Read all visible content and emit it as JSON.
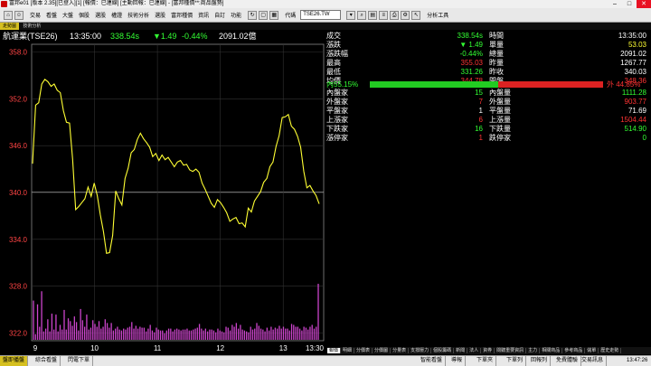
{
  "titlebar": {
    "title": "富邦e01 [版本 2.35][已登入][1] [報價：已連線] [主動回報：已連線] - [富邦種價**:商品盤勢]"
  },
  "toolbar": {
    "items": [
      "交易",
      "看盤",
      "大盤",
      "個股",
      "選股",
      "權證",
      "技術分析",
      "選股",
      "富邦種價",
      "資訊",
      "自訂",
      "功能"
    ],
    "code_label": "代碼",
    "code_value": "TSE26.TW",
    "analysis_label": "分析工具"
  },
  "doc_tabs": [
    "走勢圖",
    "技術分析"
  ],
  "header": {
    "name": "航運業(TSE26)",
    "time": "13:35:00",
    "price": "338.54s",
    "change": "▼1.49",
    "pct": "-0.44%",
    "amount": "2091.02億"
  },
  "chart_data": {
    "type": "line",
    "title": "",
    "x_ticks": [
      "9",
      "10",
      "11",
      "12",
      "13",
      "13:30"
    ],
    "y_ticks": [
      "358.0",
      "352.0",
      "346.0",
      "340.0",
      "334.0",
      "328.0",
      "322.0"
    ],
    "ylim": [
      321.0,
      359.0
    ],
    "reference": 340.03,
    "grid": true,
    "line_color": "#ffff33",
    "volume_color": "#cc44cc",
    "series": [
      {
        "values": [
          343.7,
          351.2,
          351.5,
          353.9,
          354.5,
          354.2,
          353.6,
          353.9,
          353.1,
          352.8,
          350.5,
          349.0,
          348.9,
          344.3,
          337.8,
          338.2,
          338.7,
          339.2,
          340.7,
          339.5,
          341.2,
          339.6,
          337.1,
          335.0,
          332.2,
          332.3,
          334.5,
          340.2,
          339.2,
          338.4,
          341.8,
          343.1,
          345.1,
          345.5,
          346.8,
          347.6,
          346.9,
          346.4,
          345.8,
          344.6,
          345.0,
          344.1,
          344.8,
          344.2,
          344.5,
          343.9,
          343.3,
          343.9,
          344.1,
          343.5,
          343.6,
          342.9,
          342.7,
          343.0,
          342.6,
          341.2,
          340.4,
          339.5,
          338.6,
          338.1,
          339.1,
          338.7,
          338.1,
          337.4,
          336.3,
          336.6,
          336.8,
          336.0,
          336.1,
          335.6,
          338.0,
          337.5,
          338.9,
          339.5,
          340.1,
          341.3,
          341.8,
          343.3,
          343.9,
          345.9,
          347.3,
          349.6,
          349.7,
          350.0,
          348.5,
          348.1,
          347.2,
          345.8,
          342.7,
          340.6,
          340.9,
          340.2,
          339.6,
          338.54
        ]
      }
    ],
    "volume": [
      42,
      6,
      38,
      14,
      52,
      9,
      12,
      22,
      9,
      28,
      11,
      27,
      9,
      16,
      11,
      32,
      11,
      23,
      20,
      15,
      25,
      19,
      10,
      33,
      21,
      14,
      27,
      11,
      13,
      21,
      17,
      14,
      20,
      12,
      14,
      22,
      18,
      13,
      18,
      10,
      12,
      14,
      11,
      10,
      12,
      11,
      13,
      14,
      19,
      12,
      15,
      12,
      14,
      13,
      13,
      9,
      12,
      16,
      10,
      8,
      13,
      11,
      10,
      10,
      7,
      10,
      12,
      12,
      9,
      11,
      12,
      11,
      10,
      11,
      11,
      12,
      10,
      10,
      11,
      12,
      13,
      17,
      12,
      10,
      12,
      9,
      11,
      11,
      10,
      8,
      12,
      10,
      9,
      8,
      14,
      13,
      10,
      16,
      14,
      18,
      12,
      16,
      11,
      10,
      9,
      8,
      14,
      11,
      12,
      18,
      15,
      12,
      11,
      9,
      13,
      10,
      14,
      11,
      13,
      12,
      15,
      12,
      14,
      12,
      12,
      10,
      17,
      16,
      14,
      14,
      12,
      10,
      14,
      13,
      11,
      14,
      16,
      12,
      14,
      60
    ]
  },
  "quote": {
    "left": [
      {
        "label": "成交",
        "value": "338.54s",
        "color": "#33ff33"
      },
      {
        "label": "漲跌",
        "value": "▼ 1.49",
        "color": "#33ff33"
      },
      {
        "label": "漲跌幅",
        "value": "-0.44%",
        "color": "#33ff33"
      },
      {
        "label": "最高",
        "value": "355.03",
        "color": "#ff3333"
      },
      {
        "label": "最低",
        "value": "331.26",
        "color": "#33ff33"
      },
      {
        "label": "均價",
        "value": "344.78",
        "color": "#ff3333"
      }
    ],
    "right": [
      {
        "label": "時間",
        "value": "13:35:00",
        "color": "#ffffff"
      },
      {
        "label": "單量",
        "value": "53.03",
        "color": "#ffff33"
      },
      {
        "label": "總量",
        "value": "2091.02",
        "color": "#ffffff"
      },
      {
        "label": "昨量",
        "value": "1267.77",
        "color": "#ffffff"
      },
      {
        "label": "昨收",
        "value": "340.03",
        "color": "#ffffff"
      },
      {
        "label": "開盤",
        "value": "348.36",
        "color": "#ff3333"
      }
    ],
    "ratio": {
      "inner_label": "內55.15%",
      "outer_label": "外 44.85%",
      "inner_fraction": 0.5515
    },
    "left2": [
      {
        "label": "內盤家",
        "value": "15",
        "color": "#33ff33"
      },
      {
        "label": "外盤家",
        "value": "7",
        "color": "#ff3333"
      },
      {
        "label": "平盤家",
        "value": "1",
        "color": "#ffffff"
      },
      {
        "label": "上漲家",
        "value": "6",
        "color": "#ff3333"
      },
      {
        "label": "下跌家",
        "value": "16",
        "color": "#33ff33"
      },
      {
        "label": "漲停家",
        "value": "1",
        "color": "#ff3333"
      }
    ],
    "right2": [
      {
        "label": "內盤量",
        "value": "1111.28",
        "color": "#33ff33"
      },
      {
        "label": "外盤量",
        "value": "903.77",
        "color": "#ff3333"
      },
      {
        "label": "平盤量",
        "value": "71.69",
        "color": "#ffffff"
      },
      {
        "label": "上漲量",
        "value": "1504.44",
        "color": "#ff3333"
      },
      {
        "label": "下跌量",
        "value": "514.90",
        "color": "#33ff33"
      },
      {
        "label": "跌停家",
        "value": "0",
        "color": "#33ff33"
      }
    ]
  },
  "bottom_tabs": [
    "報價",
    "明細",
    "分價表",
    "分價圖",
    "分量表",
    "支撐壓力",
    "個股籌碼",
    "新聞",
    "法人",
    "資券",
    "閱聽重要資訊",
    "主力",
    "相關商品",
    "參考商品",
    "儲單",
    "歷史走勢"
  ],
  "status": {
    "left": [
      "盤即播盤",
      "綜合看盤",
      "閃電下單"
    ],
    "right": [
      "智能看盤",
      "導報",
      "下單夾",
      "下單列",
      "回報列",
      "免費體驗",
      "交易訊息"
    ],
    "clock": "13:47:26"
  }
}
